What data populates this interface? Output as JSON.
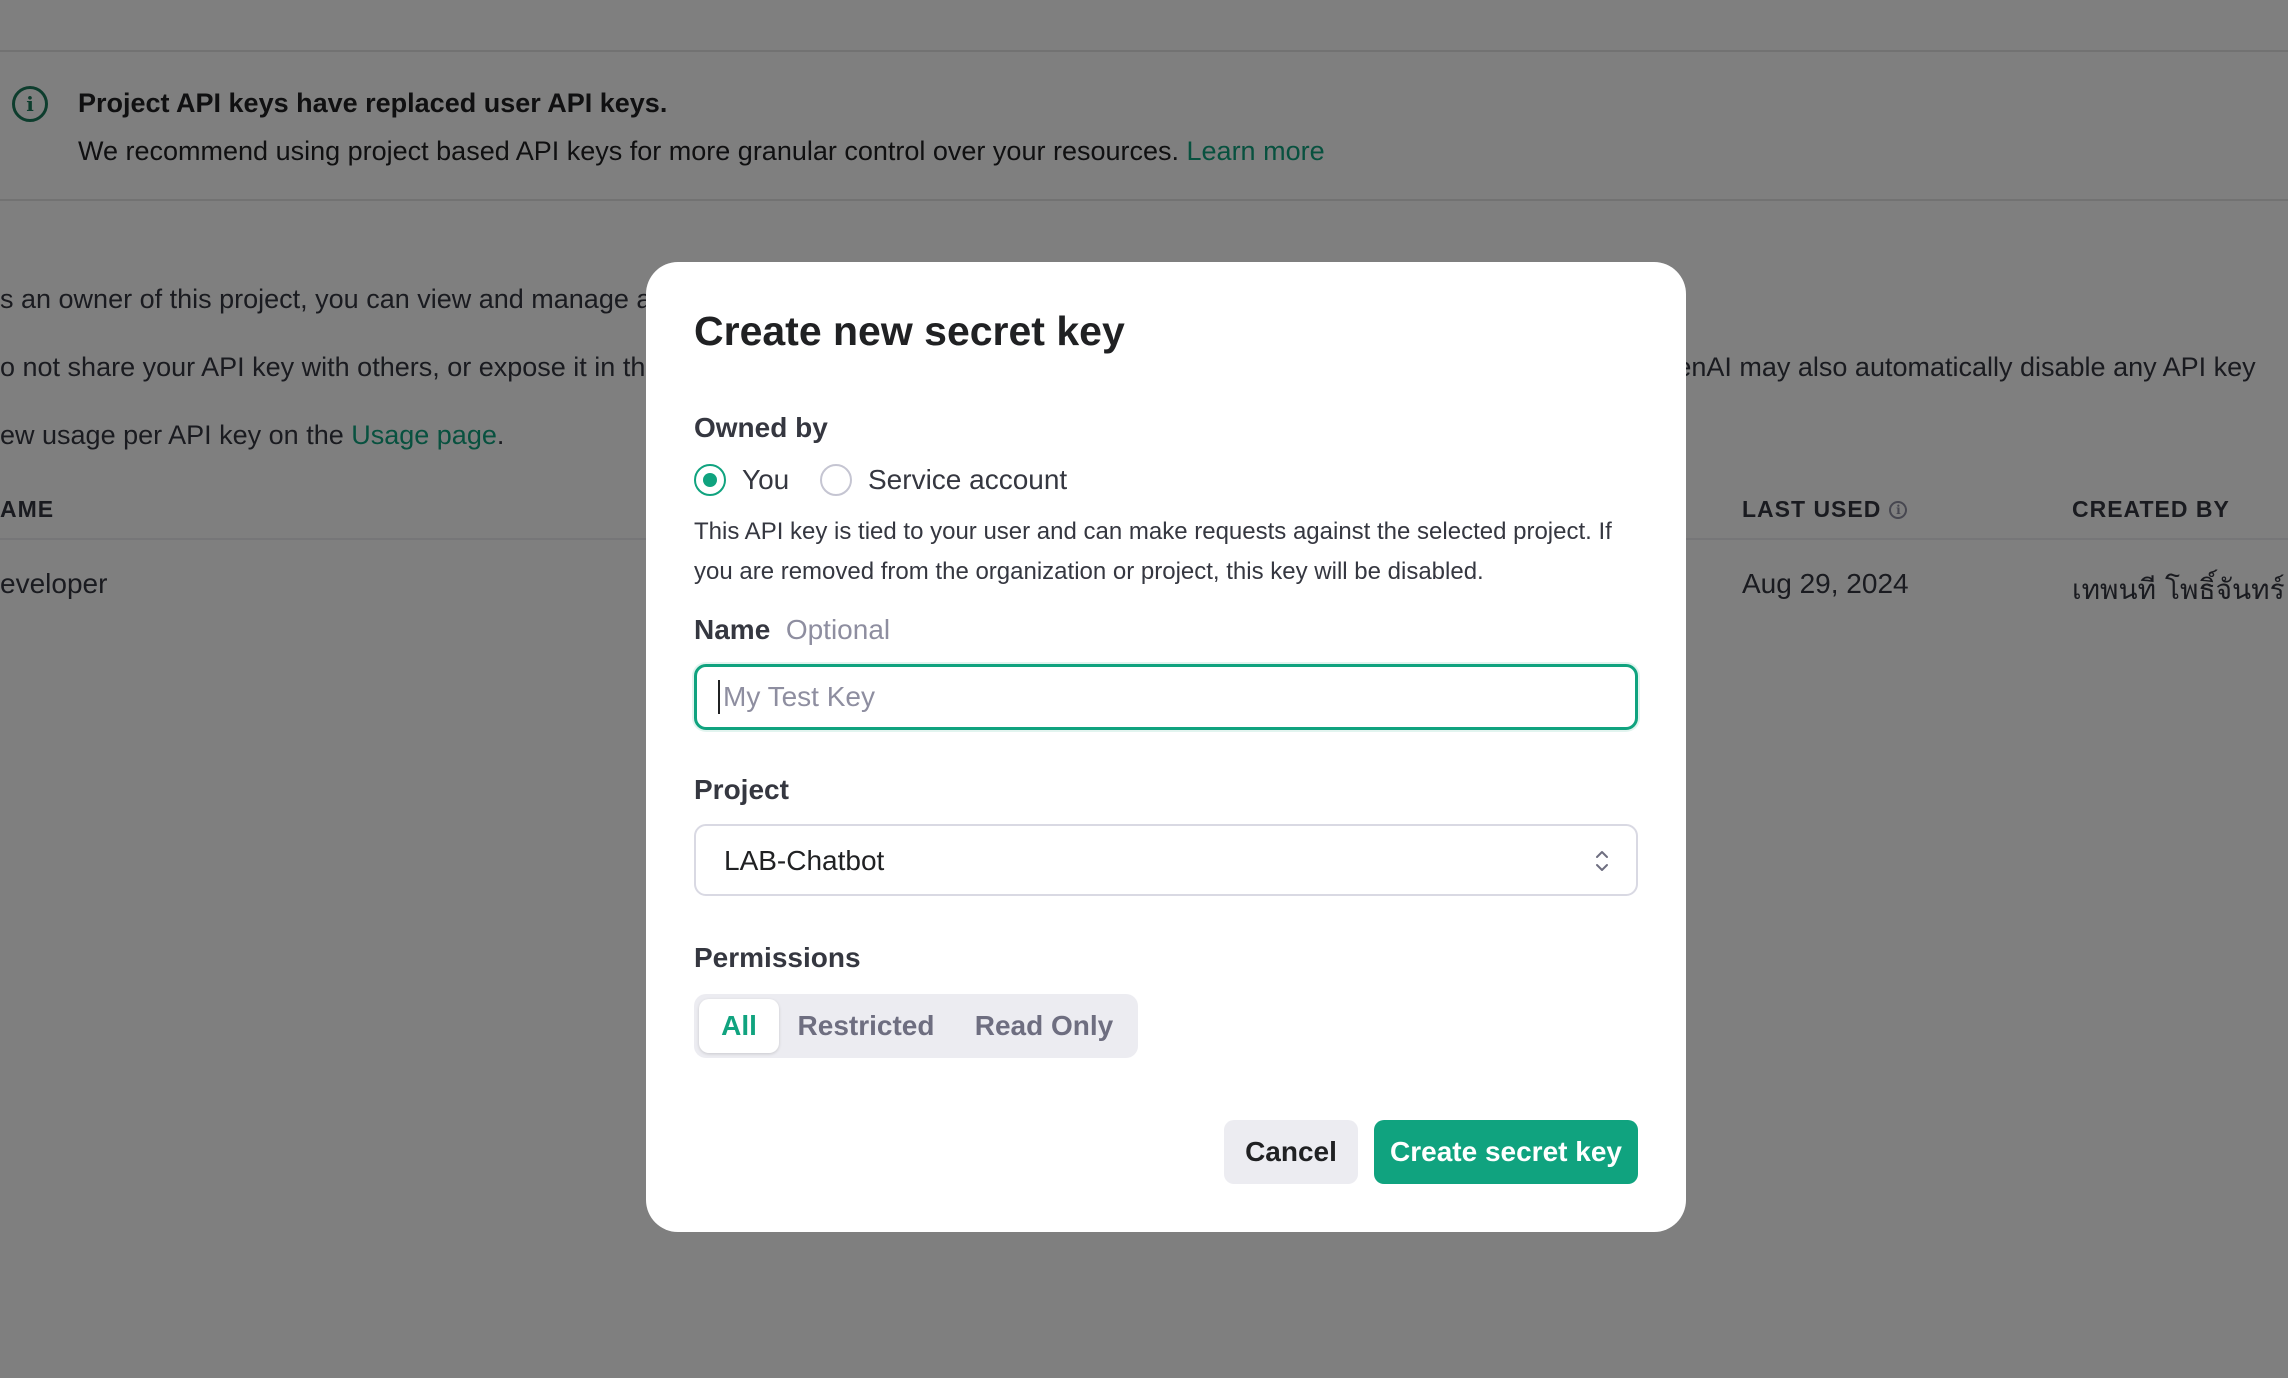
{
  "notice": {
    "title": "Project API keys have replaced user API keys.",
    "body": "We recommend using project based API keys for more granular control over your resources. ",
    "link": "Learn more"
  },
  "background": {
    "line1": "s an owner of this project, you can view and manage all API keys in this project.",
    "line2": "o not share your API key with others, or expose it in the browser or other client-side code. In order to protect the security of your account, OpenAI may also automatically disable any API key",
    "line3_prefix": "ew usage per API key on the ",
    "line3_link": "Usage page",
    "line3_suffix": ".",
    "table": {
      "headers": {
        "name": "AME",
        "last_used": "LAST USED",
        "created_by": "CREATED BY"
      },
      "row": {
        "name": "eveloper",
        "last_used": "Aug 29, 2024",
        "created_by": "เทพนที โพธิ์จันทร์"
      }
    }
  },
  "modal": {
    "title": "Create new secret key",
    "owned_by_label": "Owned by",
    "owner_options": [
      {
        "label": "You",
        "selected": true
      },
      {
        "label": "Service account",
        "selected": false
      }
    ],
    "help_text": "This API key is tied to your user and can make requests against the selected project. If you are removed from the organization or project, this key will be disabled.",
    "name_label": "Name",
    "name_optional": "Optional",
    "name_placeholder": "My Test Key",
    "name_value": "",
    "project_label": "Project",
    "project_value": "LAB-Chatbot",
    "permissions_label": "Permissions",
    "permissions": [
      {
        "label": "All",
        "active": true
      },
      {
        "label": "Restricted",
        "active": false
      },
      {
        "label": "Read Only",
        "active": false
      }
    ],
    "cancel_label": "Cancel",
    "create_label": "Create secret key"
  },
  "colors": {
    "accent": "#10a37f",
    "overlay": "rgba(0,0,0,0.5)"
  }
}
